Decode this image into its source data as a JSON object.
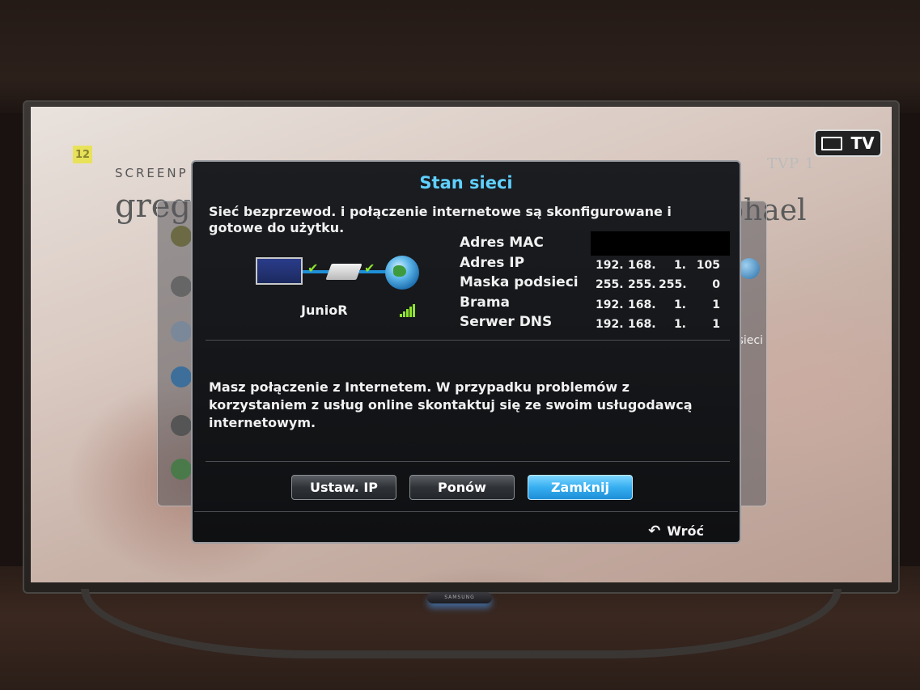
{
  "background": {
    "badge": "12",
    "small_title": "SCREENP",
    "name_left": "greg",
    "name_right": "phael",
    "logo_right": "TVP 1",
    "panel_right_text": "sieci"
  },
  "tv_source_button": {
    "label": "TV",
    "icon": "tv-source-icon"
  },
  "dialog": {
    "title": "Stan sieci",
    "status_text": "Sieć bezprzewod. i połączenie internetowe są skonfigurowane i gotowe do użytku.",
    "ssid": "JunioR",
    "labels": {
      "mac": "Adres MAC",
      "ip": "Adres IP",
      "mask": "Maska podsieci",
      "gateway": "Brama",
      "dns": "Serwer DNS"
    },
    "values": {
      "ip": [
        "192.",
        "168.",
        "1.",
        "105"
      ],
      "mask": [
        "255.",
        "255.",
        "255.",
        "0"
      ],
      "gateway": [
        "192.",
        "168.",
        "1.",
        "1"
      ],
      "dns": [
        "192.",
        "168.",
        "1.",
        "1"
      ]
    },
    "message": "Masz połączenie z Internetem. W przypadku problemów z korzystaniem z usług online skontaktuj się ze swoim usługodawcą internetowym.",
    "buttons": {
      "set_ip": "Ustaw. IP",
      "retry": "Ponów",
      "close": "Zamknij"
    },
    "back_label": "Wróć",
    "signal_level": 5,
    "accent_color": "#5fd0ff",
    "check_color": "#8fe32f"
  },
  "brand": "SAMSUNG"
}
